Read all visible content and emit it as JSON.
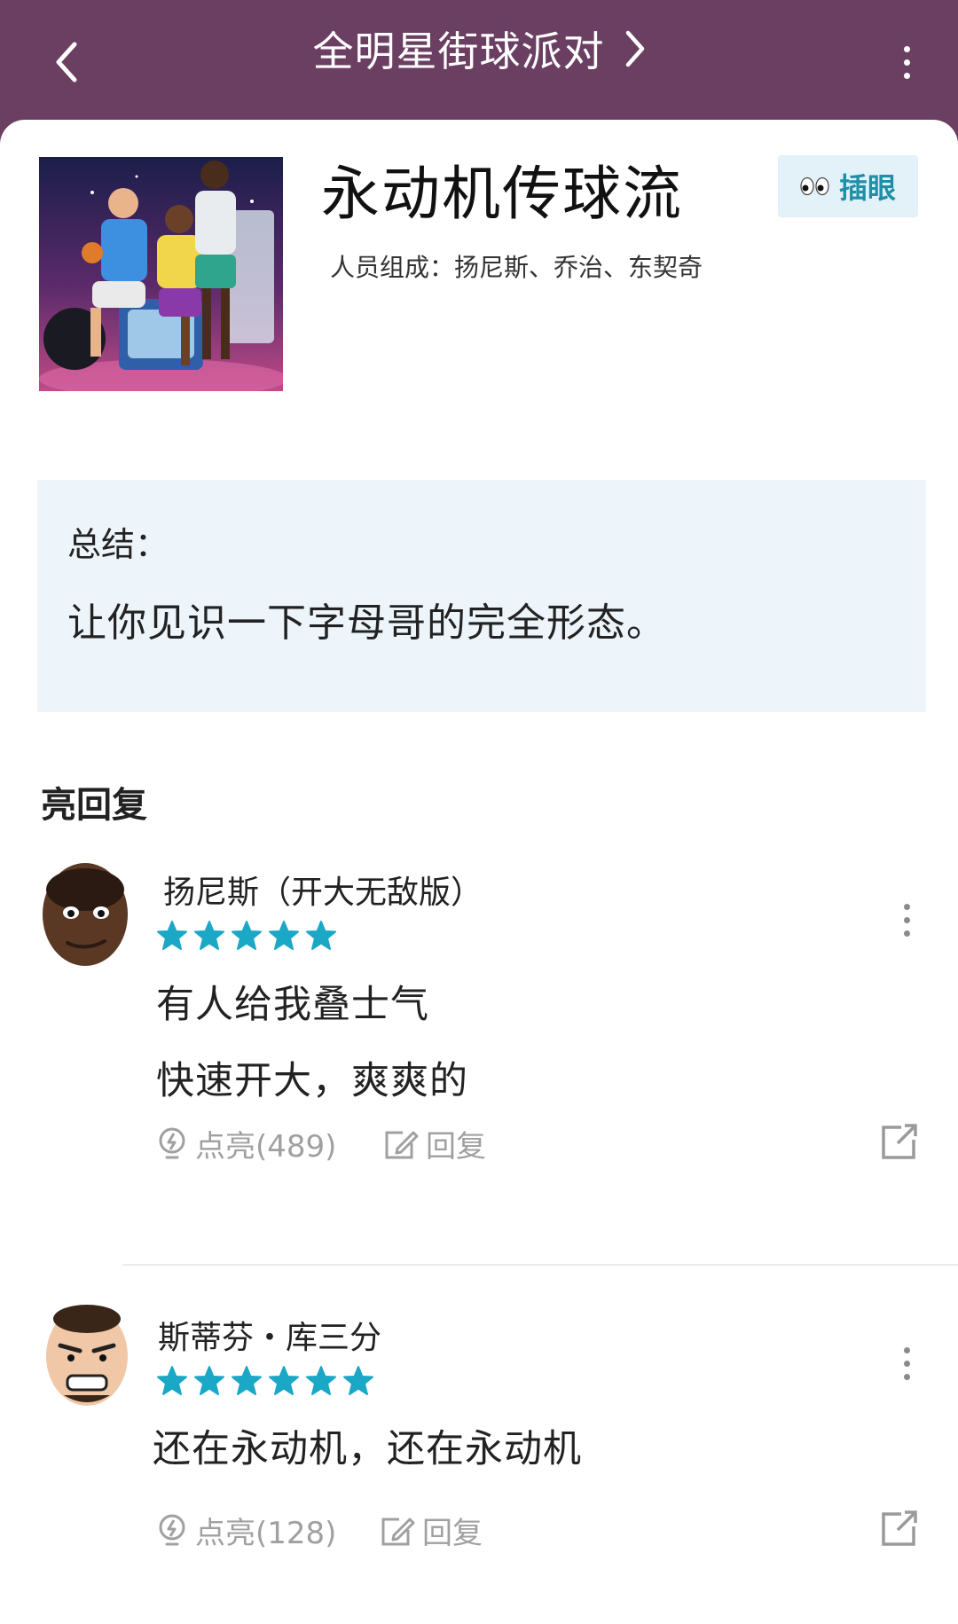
{
  "header": {
    "title": "全明星街球派对"
  },
  "deck": {
    "title": "永动机传球流",
    "members": "人员组成：扬尼斯、乔治、东契奇",
    "peek_label": "插眼"
  },
  "summary": {
    "label": "总结：",
    "text": "让你见识一下字母哥的完全形态。"
  },
  "section_title": "亮回复",
  "comments": [
    {
      "name": "扬尼斯（开大无敌版）",
      "stars": 5,
      "lines": [
        "有人给我叠士气",
        "快速开大，爽爽的"
      ],
      "like_label": "点亮(489)",
      "reply_label": "回复"
    },
    {
      "name": "斯蒂芬・库三分",
      "stars": 6,
      "lines": [
        "还在永动机，还在永动机"
      ],
      "like_label": "点亮(128)",
      "reply_label": "回复"
    }
  ],
  "colors": {
    "header_bg": "#6b3f62",
    "star": "#1ba7c6",
    "accent": "#1f8fa8",
    "summary_bg": "#edf5fa"
  }
}
